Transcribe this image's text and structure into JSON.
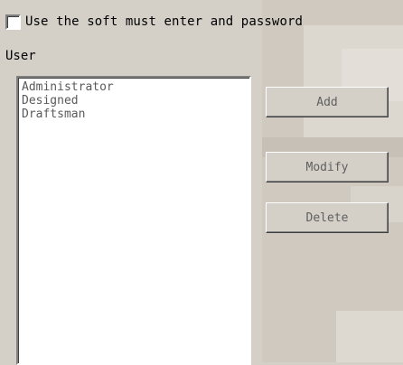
{
  "login_required": {
    "label": "Use the soft must enter and password",
    "checked": false
  },
  "user_group": {
    "label": "User",
    "items": [
      "Administrator",
      "Designed",
      "Draftsman"
    ]
  },
  "buttons": {
    "add": "Add",
    "modify": "Modify",
    "delete": "Delete"
  }
}
